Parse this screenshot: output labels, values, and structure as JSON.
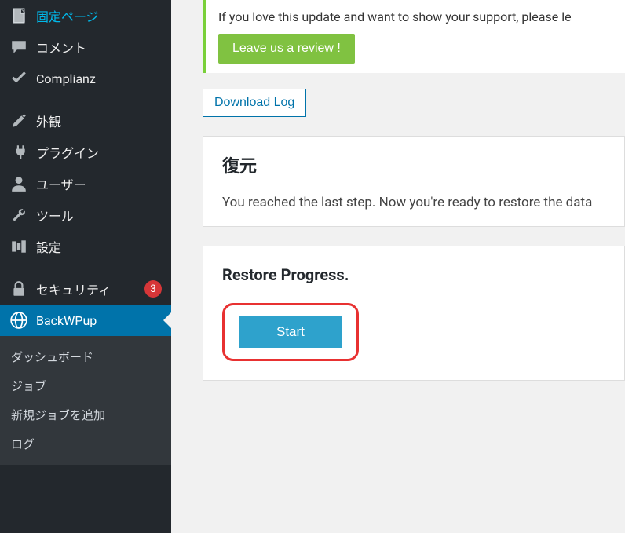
{
  "sidebar": {
    "items": [
      {
        "label": "固定ページ",
        "icon": "page"
      },
      {
        "label": "コメント",
        "icon": "comment"
      },
      {
        "label": "Complianz",
        "icon": "check"
      },
      {
        "label": "外観",
        "icon": "brush"
      },
      {
        "label": "プラグイン",
        "icon": "plugin"
      },
      {
        "label": "ユーザー",
        "icon": "user"
      },
      {
        "label": "ツール",
        "icon": "wrench"
      },
      {
        "label": "設定",
        "icon": "settings"
      },
      {
        "label": "セキュリティ",
        "icon": "lock",
        "badge": "3"
      },
      {
        "label": "BackWPup",
        "icon": "globe",
        "active": true
      }
    ],
    "submenu": [
      {
        "label": "ダッシュボード"
      },
      {
        "label": "ジョブ"
      },
      {
        "label": "新規ジョブを追加"
      },
      {
        "label": "ログ"
      }
    ]
  },
  "notice": {
    "text": "If you love this update and want to show your support, please le",
    "button": "Leave us a review !"
  },
  "download_log": "Download Log",
  "restore": {
    "title": "復元",
    "text": "You reached the last step. Now you're ready to restore the data"
  },
  "progress": {
    "title": "Restore Progress.",
    "button": "Start"
  }
}
